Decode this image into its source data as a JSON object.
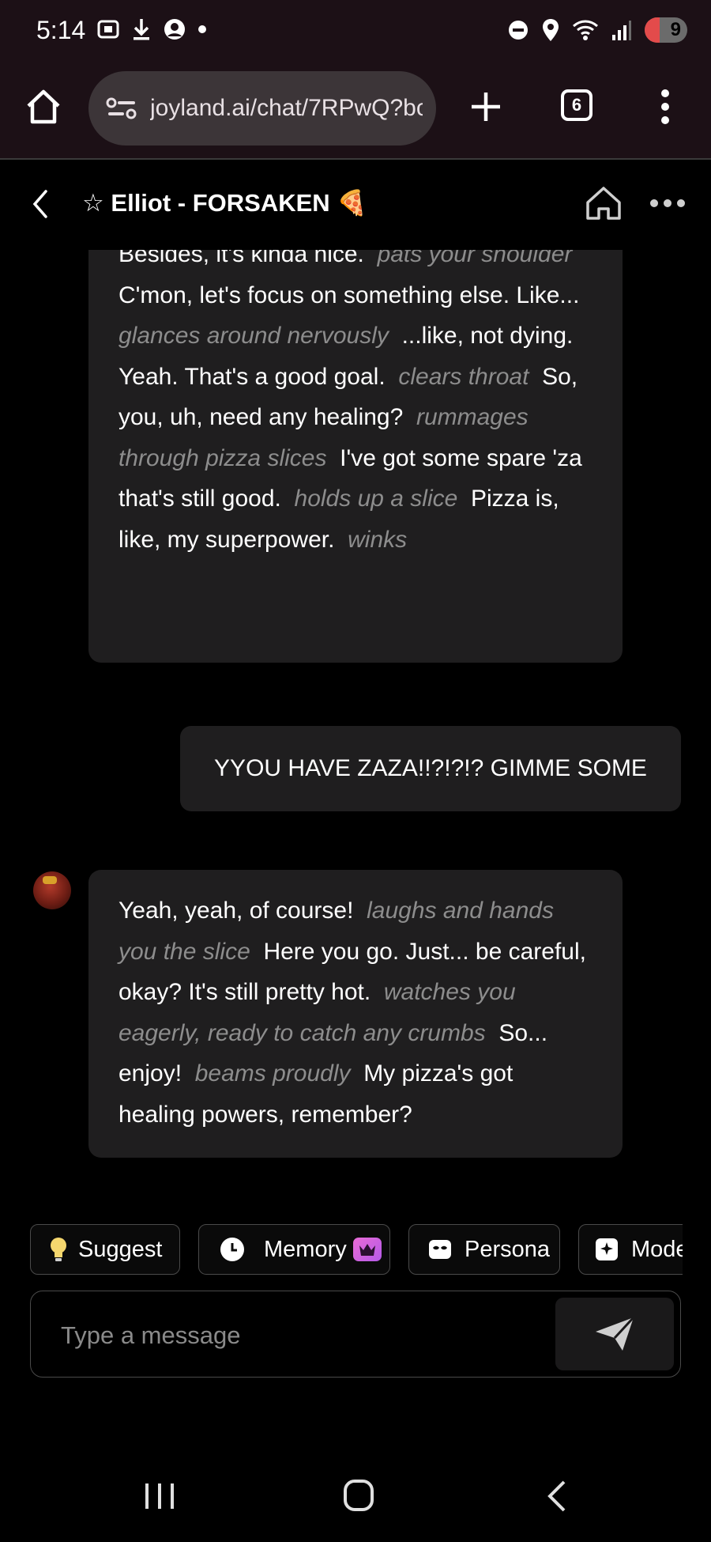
{
  "status_bar": {
    "time": "5:14",
    "battery_level": "9",
    "battery_fraction": 0.09,
    "battery_color": "#e34b4b"
  },
  "browser": {
    "url": "joyland.ai/chat/7RPwQ?bc",
    "tab_count": "6"
  },
  "chat": {
    "title": "☆ Elliot - FORSAKEN 🍕"
  },
  "messages": [
    {
      "role": "bot",
      "parts": [
        {
          "t": "text",
          "v": "Besides, it's kinda nice."
        },
        {
          "t": "action",
          "v": "pats your shoulder"
        },
        {
          "t": "text",
          "v": "C'mon, let's focus on something else. Like..."
        },
        {
          "t": "action",
          "v": "glances around nervously"
        },
        {
          "t": "text",
          "v": "...like, not dying. Yeah. That's a good goal."
        },
        {
          "t": "action",
          "v": "clears throat"
        },
        {
          "t": "text",
          "v": "So, you, uh, need any healing?"
        },
        {
          "t": "action",
          "v": "rummages through pizza slices"
        },
        {
          "t": "text",
          "v": "I've got some spare 'za that's still good."
        },
        {
          "t": "action",
          "v": "holds up a slice"
        },
        {
          "t": "text",
          "v": "Pizza is, like, my superpower."
        },
        {
          "t": "action",
          "v": "winks"
        }
      ]
    },
    {
      "role": "user",
      "text": "YYOU HAVE ZAZA!!?!?!? GIMME SOME"
    },
    {
      "role": "bot",
      "parts": [
        {
          "t": "text",
          "v": "Yeah, yeah, of course!"
        },
        {
          "t": "action",
          "v": "laughs and hands you the slice"
        },
        {
          "t": "text",
          "v": "Here you go. Just... be careful, okay? It's still pretty hot."
        },
        {
          "t": "action",
          "v": "watches you eagerly, ready to catch any crumbs"
        },
        {
          "t": "text",
          "v": "So... enjoy!"
        },
        {
          "t": "action",
          "v": "beams proudly"
        },
        {
          "t": "text",
          "v": "My pizza's got healing powers, remember?"
        }
      ]
    }
  ],
  "chips": {
    "suggest": "Suggest",
    "memory": "Memory",
    "persona": "Persona",
    "mode": "Mode"
  },
  "composer": {
    "placeholder": "Type a message"
  },
  "icons": {
    "suggest": "lightbulb-icon",
    "memory": "clock-icon",
    "memory_badge": "crown-icon",
    "persona": "mask-icon",
    "mode": "sparkle-icon",
    "send": "send-icon"
  }
}
